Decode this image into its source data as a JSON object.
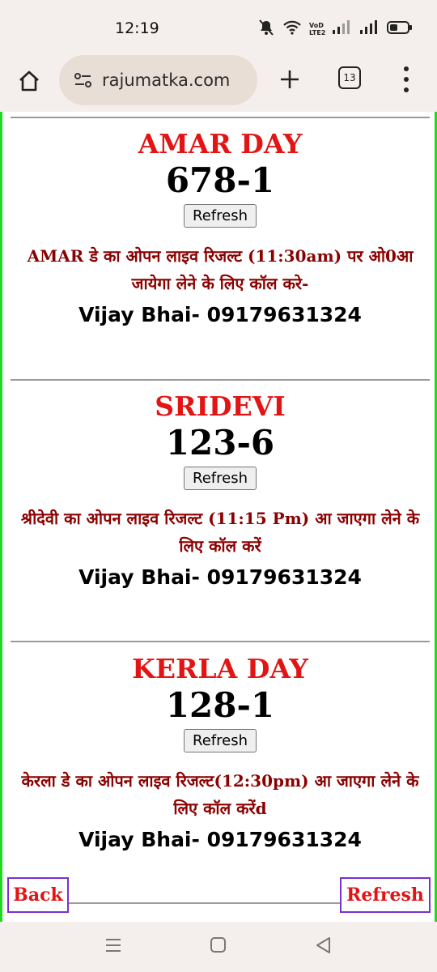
{
  "status_bar": {
    "time": "12:19",
    "network_label": "VoD LTE2"
  },
  "browser": {
    "url": "rajumatka.com",
    "tab_count": "13"
  },
  "games": [
    {
      "name": "AMAR DAY",
      "result": "678-1",
      "refresh_label": "Refresh",
      "info": "AMAR डे का ओपन लाइव रिजल्ट (11:30am) पर ओ0आ जायेगा लेने के लिए कॉल करे-",
      "contact": "Vijay Bhai- 09179631324"
    },
    {
      "name": "SRIDEVI",
      "result": "123-6",
      "refresh_label": "Refresh",
      "info": "श्रीदेवी का ओपन लाइव रिजल्ट (11:15 Pm) आ जाएगा लेने के लिए कॉल करें",
      "contact": "Vijay Bhai- 09179631324"
    },
    {
      "name": "KERLA DAY",
      "result": "128-1",
      "refresh_label": "Refresh",
      "info": "केरला डे का ओपन लाइव रिजल्ट(12:30pm) आ जाएगा लेने के लिए कॉल करेंd",
      "contact": "Vijay Bhai- 09179631324"
    }
  ],
  "footer_buttons": {
    "back": "Back",
    "refresh": "Refresh"
  },
  "colors": {
    "accent_red": "#e31414",
    "info_red": "#8b0000",
    "border_green": "#22d922",
    "button_border": "#7a2fd0"
  }
}
